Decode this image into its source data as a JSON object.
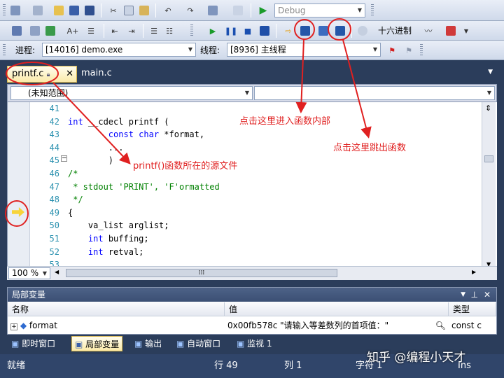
{
  "toolbar1": {
    "config_combo": "Debug"
  },
  "toolbar2": {
    "hex_label": "十六进制"
  },
  "toolbar3": {
    "process_label": "进程:",
    "process_value": "[14016] demo.exe",
    "thread_label": "线程:",
    "thread_value": "[8936] 主线程"
  },
  "tabs": {
    "active": "printf.c",
    "other": "main.c"
  },
  "editor": {
    "scope": "(未知范围)",
    "lines": [
      {
        "n": "41",
        "text": ""
      },
      {
        "n": "42",
        "kw": "int",
        "text": " __cdecl printf ("
      },
      {
        "n": "43",
        "indent": "        ",
        "kw": "const char",
        "text": " *format,"
      },
      {
        "n": "44",
        "indent": "        ",
        "text": "..."
      },
      {
        "n": "45",
        "indent": "        ",
        "text": ")"
      },
      {
        "n": "46",
        "comment": "/*"
      },
      {
        "n": "47",
        "comment": " * stdout 'PRINT', 'F'ormatted"
      },
      {
        "n": "48",
        "comment": " */"
      },
      {
        "n": "49",
        "text": "{"
      },
      {
        "n": "50",
        "indent": "    ",
        "text": "va_list arglist;"
      },
      {
        "n": "51",
        "indent": "    ",
        "kw": "int",
        "text": " buffing;"
      },
      {
        "n": "52",
        "indent": "    ",
        "kw": "int",
        "text": " retval;"
      },
      {
        "n": "53",
        "text": ""
      }
    ],
    "zoom": "100 %"
  },
  "locals": {
    "title": "局部变量",
    "col_name": "名称",
    "col_value": "值",
    "col_type": "类型",
    "row": {
      "name": "format",
      "value": "0x00fb578c \"请输入等差数列的首项值：\"",
      "type": "const c"
    }
  },
  "bottom_tabs": [
    "即时窗口",
    "局部变量",
    "输出",
    "自动窗口",
    "监视 1"
  ],
  "status": {
    "ready": "就绪",
    "line": "行 49",
    "col": "列 1",
    "ch": "字符 1",
    "ins": "Ins"
  },
  "annotations": {
    "step_into": "点击这里进入函数内部",
    "step_out": "点击这里跳出函数",
    "source_file": "printf()函数所在的源文件"
  },
  "watermark": "知乎 @编程小天才",
  "colors": {
    "annotation": "#e02020",
    "keyword": "#0000ff",
    "comment": "#008000",
    "line_number": "#2b91af"
  }
}
